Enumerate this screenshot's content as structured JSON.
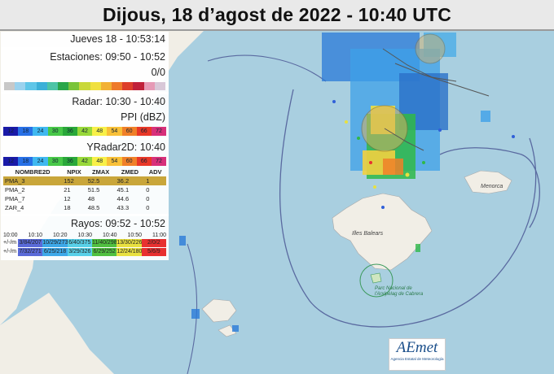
{
  "title": "Dijous, 18 d’agost de 2022 - 10:40 UTC",
  "panel": {
    "datetime": "Jueves 18 - 10:53:14",
    "stations": "Estaciones: 09:50 - 10:52",
    "stations_count": "0/0",
    "station_colors": [
      "#c8c8c8",
      "#9ad2ee",
      "#5fc6e8",
      "#3cb0d8",
      "#4dc4a6",
      "#2aa64a",
      "#7ac43a",
      "#c9d83a",
      "#f0e040",
      "#f2b134",
      "#ee7a2a",
      "#dd3e2a",
      "#c0203a",
      "#e69ab6",
      "#d8c8d8"
    ],
    "radar_time": "Radar: 10:30 - 10:40",
    "radar_product": "PPI (dBZ)",
    "dbz_scale": [
      "12",
      "18",
      "24",
      "30",
      "36",
      "42",
      "48",
      "54",
      "60",
      "66",
      "72"
    ],
    "dbz_colors": [
      "#1a1aa8",
      "#2870e6",
      "#40b8f0",
      "#48c848",
      "#2aa83a",
      "#98d83a",
      "#f8f048",
      "#f8c038",
      "#f08028",
      "#e83828",
      "#d8307a"
    ],
    "yradar_time": "YRadar2D: 10:40",
    "table": {
      "headers": [
        "NOMBRE2D",
        "NPIX",
        "ZMAX",
        "ZMED",
        "ADV"
      ],
      "rows": [
        [
          "PMA_3",
          "152",
          "52.5",
          "36.2",
          "1"
        ],
        [
          "PMA_2",
          "21",
          "51.5",
          "45.1",
          "0"
        ],
        [
          "PMA_7",
          "12",
          "48",
          "44.6",
          "0"
        ],
        [
          "ZAR_4",
          "18",
          "48.5",
          "43.3",
          "0"
        ]
      ]
    },
    "rayos_time": "Rayos: 09:52 - 10:52",
    "rayos_ticks": [
      "10:00",
      "10:10",
      "10:20",
      "10:30",
      "10:40",
      "10:50",
      "11:00"
    ],
    "rayos_rows": [
      {
        "label": "+/-/m",
        "cells": [
          "3/84/207",
          "10/29/273",
          "6/40/375",
          "11/40/298",
          "13/30/226",
          "2/0/2"
        ]
      },
      {
        "label": "+/-/m",
        "cells": [
          "7/32/271",
          "6/25/218",
          "3/29/326",
          "6/29/252",
          "12/24/180",
          "5/6/9"
        ]
      }
    ],
    "rayos_colors": [
      "#5a6ad8",
      "#3ea8e8",
      "#58d0e8",
      "#50c040",
      "#e8e040",
      "#e83030"
    ]
  },
  "map_labels": {
    "baleares": "Illes Balears",
    "menorca": "Menorca",
    "cabrera": "Parc Nacional de l'Arxipèlag de Cabrera"
  },
  "logo": {
    "name": "AEmet",
    "sub": "Agencia Estatal de Meteorología"
  }
}
